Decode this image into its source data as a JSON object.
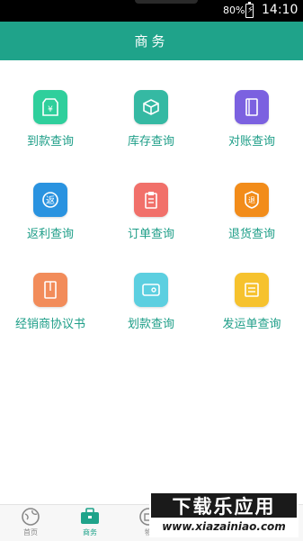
{
  "status_bar": {
    "battery": "80%",
    "time": "14:10"
  },
  "header": {
    "title": "商务"
  },
  "tiles": [
    {
      "label": "到款查询",
      "icon": "money-tag-icon",
      "color": "#2fcf9c"
    },
    {
      "label": "库存查询",
      "icon": "boxes-icon",
      "color": "#35b9a3"
    },
    {
      "label": "对账查询",
      "icon": "ledger-book-icon",
      "color": "#7b61e0"
    },
    {
      "label": "返利查询",
      "icon": "rebate-coin-icon",
      "color": "#2a93e0"
    },
    {
      "label": "订单查询",
      "icon": "clipboard-icon",
      "color": "#f1706a"
    },
    {
      "label": "退货查询",
      "icon": "return-box-icon",
      "color": "#f28c1a"
    },
    {
      "label": "经销商协议书",
      "icon": "agreement-book-icon",
      "color": "#f28c5a"
    },
    {
      "label": "划款查询",
      "icon": "card-icon",
      "color": "#5ccfe0"
    },
    {
      "label": "发运单查询",
      "icon": "waybill-icon",
      "color": "#f6c22e"
    }
  ],
  "bottom_nav": [
    {
      "label": "首页",
      "icon": "globe-icon"
    },
    {
      "label": "商务",
      "icon": "briefcase-icon"
    },
    {
      "label": "物",
      "icon": "item-icon"
    }
  ],
  "watermark": {
    "top": "下载乐应用",
    "bottom": "www.xiazainiao.com"
  }
}
